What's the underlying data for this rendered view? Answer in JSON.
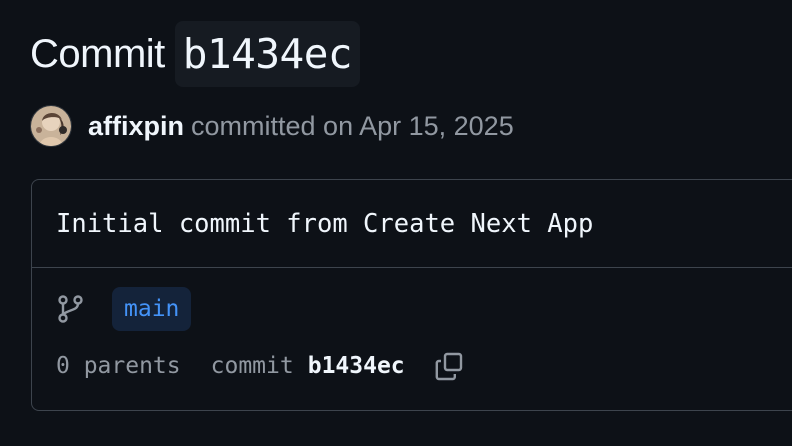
{
  "header": {
    "title_prefix": "Commit",
    "short_sha": "b1434ec"
  },
  "author": {
    "name": "affixpin",
    "meta": "committed on Apr 15, 2025",
    "avatar": "avatar-image"
  },
  "commit": {
    "message": "Initial commit from Create Next App",
    "branch_icon": "git-branch-icon",
    "branch": "main",
    "parents": "0 parents",
    "commit_label": "commit",
    "sha": "b1434ec",
    "copy_icon": "copy-icon"
  },
  "colors": {
    "background": "#0d1117",
    "text": "#f0f6fc",
    "muted": "#9198a1",
    "border": "#3d444d",
    "branch_text": "#4493f8",
    "branch_bg": "#14233a",
    "chip_bg": "#161b22"
  }
}
